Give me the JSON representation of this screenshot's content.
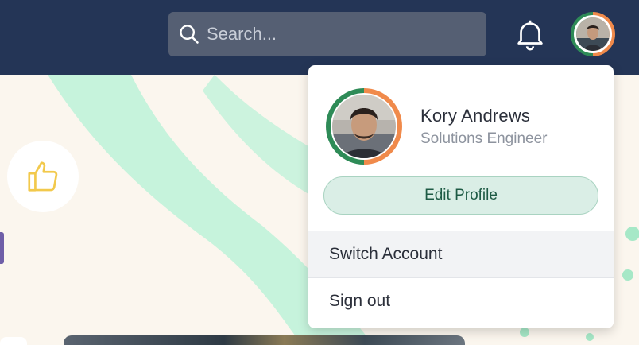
{
  "header": {
    "search": {
      "placeholder": "Search..."
    }
  },
  "user_menu": {
    "name": "Kory Andrews",
    "role": "Solutions Engineer",
    "edit_profile_label": "Edit Profile",
    "items": [
      {
        "label": "Switch Account"
      },
      {
        "label": "Sign out"
      }
    ]
  },
  "colors": {
    "topbar": "#243556",
    "avatar_ring_left": "#2e8b57",
    "avatar_ring_right": "#f08a4b",
    "background_stripe": "#c6f3dc",
    "edit_button_bg": "#daeee6",
    "thumb_icon": "#f2c94c"
  },
  "icons": [
    "search-icon",
    "bell-icon",
    "thumbs-up-icon"
  ]
}
